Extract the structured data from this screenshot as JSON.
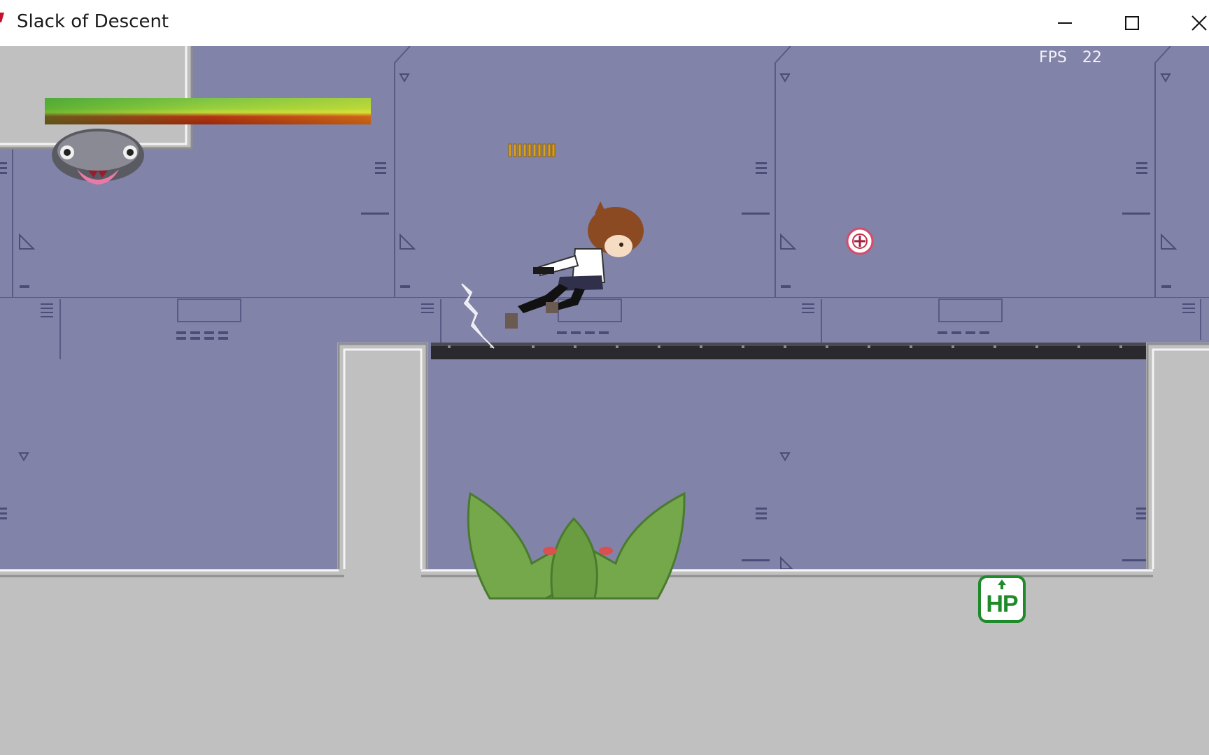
{
  "window": {
    "title": "Slack of Descent",
    "controls": [
      "minimize",
      "maximize",
      "close"
    ]
  },
  "hud": {
    "fps_label": "FPS",
    "fps_value": "22",
    "hp_bar_fraction": 1.0,
    "ammo_count": 10
  },
  "items": {
    "hp_pickup_label": "HP"
  },
  "colors": {
    "wall": "#8283a8",
    "wall_line": "#5a5a86",
    "floor": "#c0c0c0",
    "titlebar": "#ffffff",
    "plant": "#74a84a",
    "hp_green": "#1f8a2a"
  }
}
